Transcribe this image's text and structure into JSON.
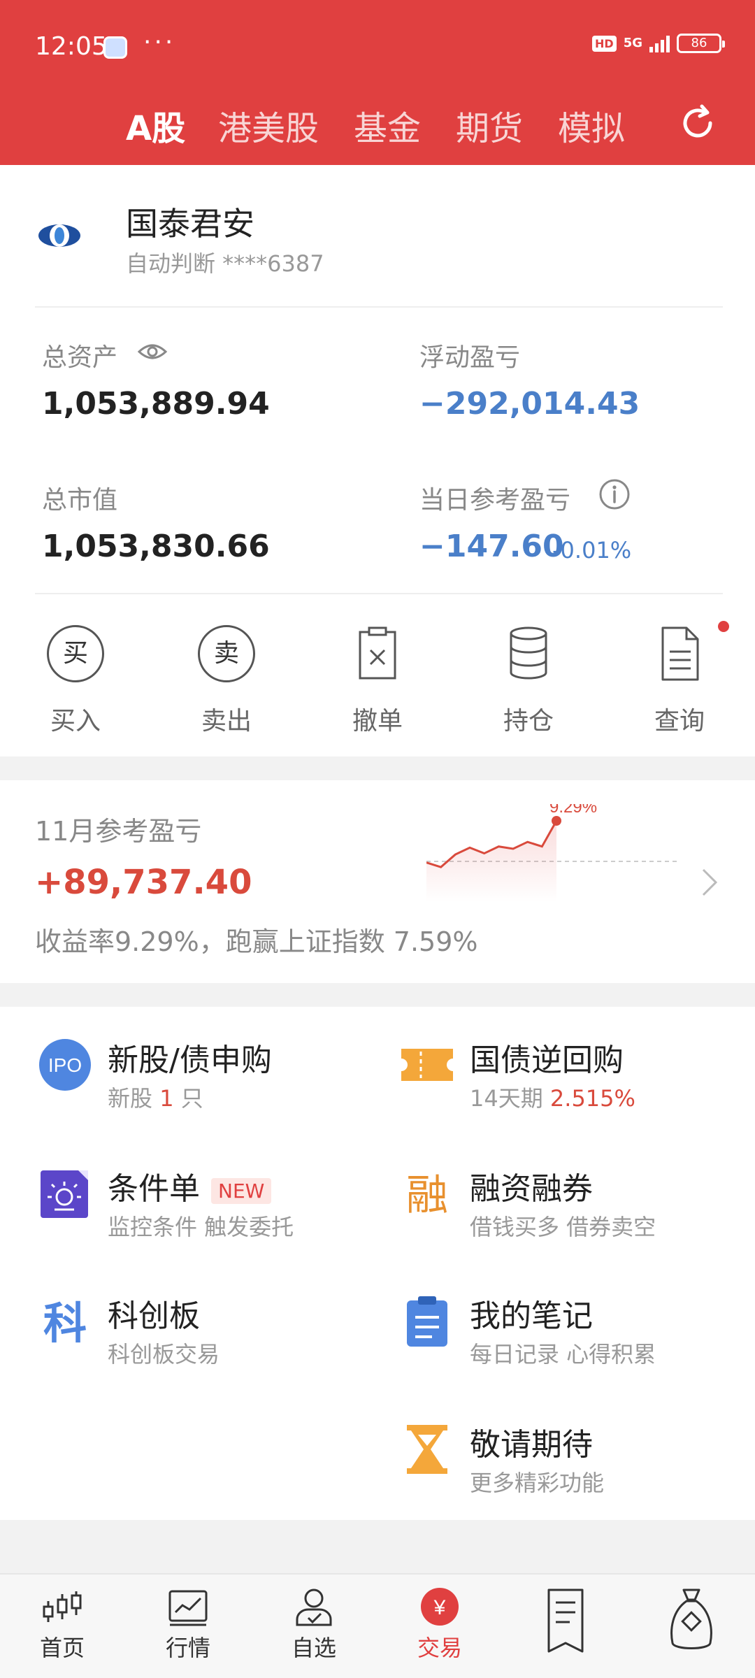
{
  "status_bar": {
    "time": "12:05",
    "dots": "···",
    "hd": "HD",
    "network": "5G",
    "battery": "86"
  },
  "market_tabs": [
    {
      "label": "A股",
      "active": true
    },
    {
      "label": "港美股",
      "active": false
    },
    {
      "label": "基金",
      "active": false
    },
    {
      "label": "期货",
      "active": false
    },
    {
      "label": "模拟",
      "active": false
    }
  ],
  "account": {
    "broker_name": "国泰君安",
    "broker_sub": "自动判断 ****6387",
    "total_assets_label": "总资产",
    "total_assets": "1,053,889.94",
    "floating_pl_label": "浮动盈亏",
    "floating_pl": "−292,014.43",
    "market_value_label": "总市值",
    "market_value": "1,053,830.66",
    "daily_pl_label": "当日参考盈亏",
    "daily_pl": "−147.60",
    "daily_pl_pct": "-0.01%"
  },
  "actions": [
    {
      "label": "买入",
      "glyph": "买"
    },
    {
      "label": "卖出",
      "glyph": "卖"
    },
    {
      "label": "撤单"
    },
    {
      "label": "持仓"
    },
    {
      "label": "查询"
    }
  ],
  "monthly": {
    "label": "11月参考盈亏",
    "value": "+89,737.40",
    "desc": "收益率9.29%，跑赢上证指数 7.59%",
    "chart_peak_label": "9.29%"
  },
  "chart_data": {
    "type": "line",
    "title": "",
    "series": [
      {
        "values": [
          2.0,
          1.2,
          3.4,
          4.6,
          3.6,
          4.8,
          4.4,
          5.6,
          4.8,
          9.29
        ]
      }
    ],
    "peak_label": "9.29%"
  },
  "services": [
    {
      "title": "新股/债申购",
      "sub_prefix": "新股 ",
      "sub_hl": "1",
      "sub_suffix": " 只",
      "icon": "ipo-icon",
      "icon_text": "IPO"
    },
    {
      "title": "国债逆回购",
      "sub_prefix": "14天期 ",
      "sub_hl": "2.515%",
      "sub_suffix": "",
      "icon": "ticket-icon"
    },
    {
      "title": "条件单",
      "badge": "NEW",
      "sub_prefix": "监控条件 触发委托",
      "icon": "condition-order-icon"
    },
    {
      "title": "融资融券",
      "sub_prefix": "借钱买多 借券卖空",
      "icon": "margin-icon",
      "icon_text": "融"
    },
    {
      "title": "科创板",
      "sub_prefix": "科创板交易",
      "icon": "star-market-icon",
      "icon_text": "科"
    },
    {
      "title": "我的笔记",
      "sub_prefix": "每日记录 心得积累",
      "icon": "clipboard-icon"
    },
    {
      "title": "敬请期待",
      "sub_prefix": "更多精彩功能",
      "icon": "hourglass-icon"
    }
  ],
  "bottom_nav": [
    {
      "label": "首页",
      "active": false
    },
    {
      "label": "行情",
      "active": false
    },
    {
      "label": "自选",
      "active": false
    },
    {
      "label": "交易",
      "active": true,
      "glyph": "¥"
    },
    {
      "label": "",
      "active": false
    },
    {
      "label": "",
      "active": false
    }
  ],
  "colors": {
    "brand_red": "#e04040",
    "loss_blue": "#4a7fc9",
    "gain_red": "#d94a3c"
  }
}
